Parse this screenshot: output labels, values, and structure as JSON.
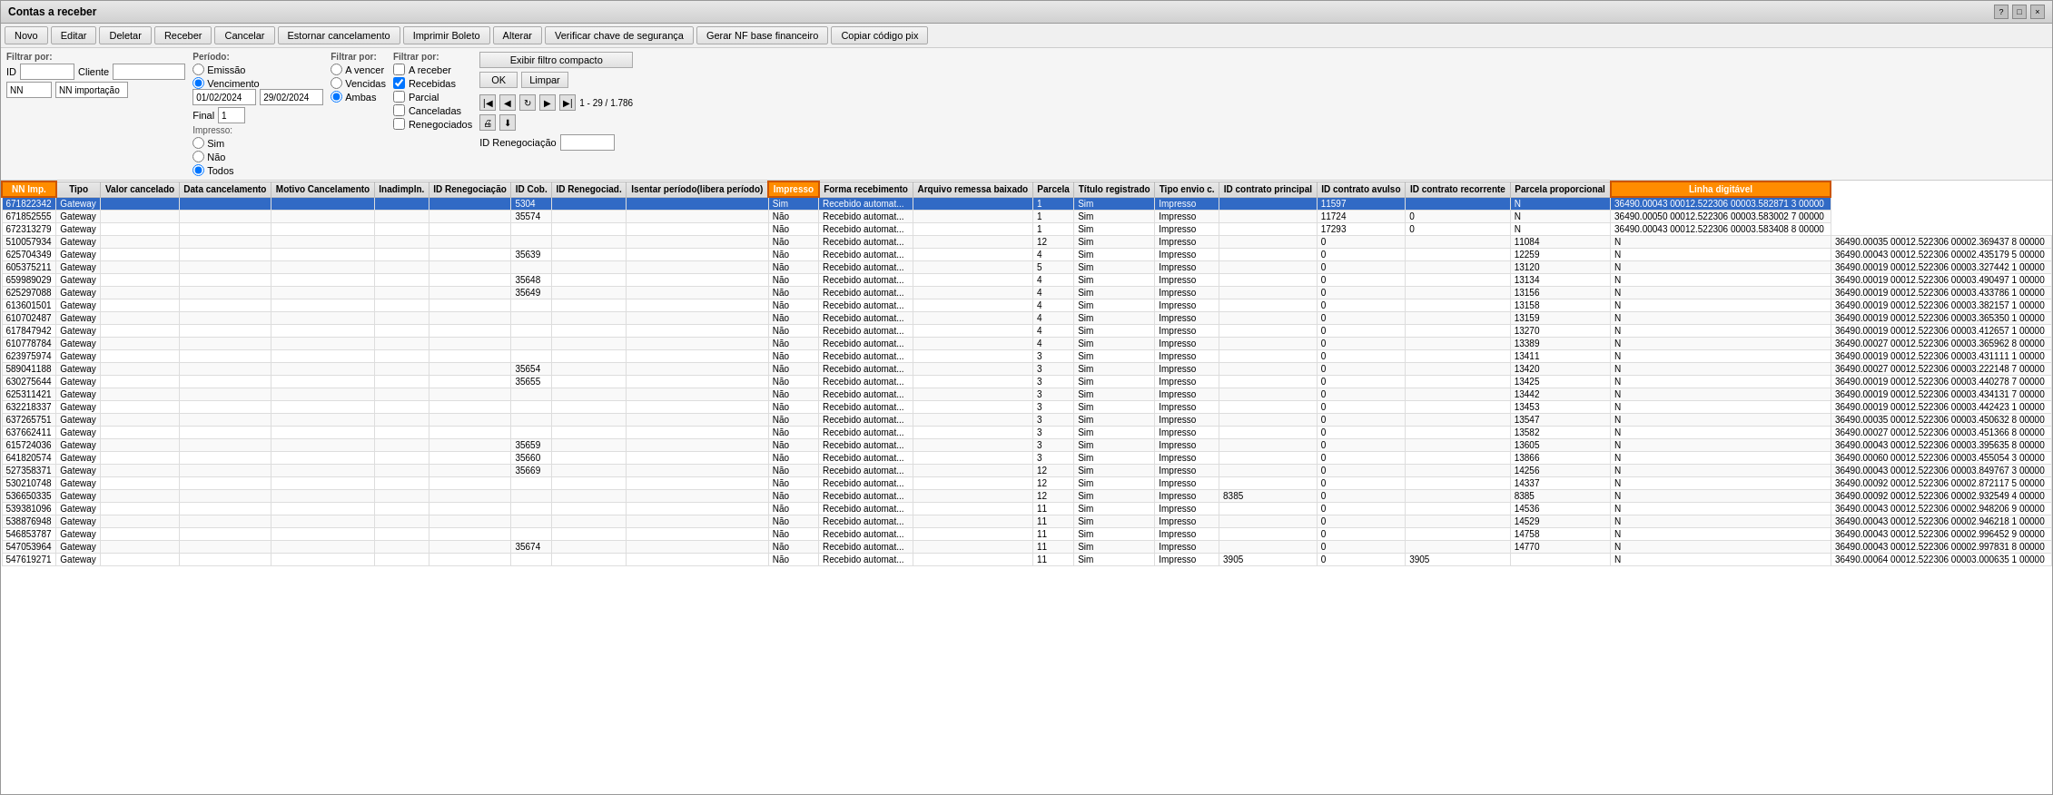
{
  "window": {
    "title": "Contas a receber",
    "title_buttons": [
      "?",
      "□",
      "×"
    ]
  },
  "toolbar": {
    "buttons": [
      "Novo",
      "Editar",
      "Deletar",
      "Receber",
      "Cancelar",
      "Estornar cancelamento",
      "Imprimir Boleto",
      "Alterar",
      "Verificar chave de segurança",
      "Gerar NF base financeiro",
      "Copiar código pix"
    ]
  },
  "filters": {
    "filtrar_por_label": "Filtrar por:",
    "id_label": "ID",
    "cliente_label": "Cliente",
    "nn_label": "NN",
    "nn_importacao_label": "NN importação",
    "periodo_label": "Período:",
    "emissao_label": "Emissão",
    "vencimento_label": "Vencimento",
    "final_label": "Final",
    "date_from": "01/02/2024",
    "date_to": "29/02/2024",
    "id_value": "",
    "cliente_value": "",
    "nn_value": "NN",
    "nn_imp_value": "NN importação",
    "final_value": "1",
    "impresso_label": "Impresso:",
    "impresso_sim": "Sim",
    "impresso_nao": "Não",
    "impresso_todos": "Todos",
    "filtrar_por2_label": "Filtrar por:",
    "a_vencer_label": "A vencer",
    "vencidas_label": "Vencidas",
    "ambas_label": "Ambas",
    "filtrar_por3_label": "Filtrar por:",
    "a_receber_label": "A receber",
    "recebidas_label": "Recebidas",
    "parcial_label": "Parcial",
    "canceladas_label": "Canceladas",
    "renegociados_label": "Renegociados",
    "exibir_filtro_compacto": "Exibir filtro compacto",
    "ok_label": "OK",
    "limpar_label": "Limpar",
    "nav_info": "1 - 29 / 1.786",
    "id_renegociacao_label": "ID Renegociação"
  },
  "table": {
    "columns": [
      "NN Imp.",
      "Tipo",
      "Valor cancelado",
      "Data cancelamento",
      "Motivo Cancelamento",
      "Inadimpln.",
      "ID Renegociação",
      "ID Cob.",
      "ID Renegociad.",
      "Isentar período(libera período)",
      "Impresso",
      "Forma recebimento",
      "Arquivo remessa baixado",
      "Parcela",
      "Título registrado",
      "Tipo envio c.",
      "ID contrato principal",
      "ID contrato avulso",
      "ID contrato recorrente",
      "Parcela proporcional",
      "Linha digitável"
    ],
    "rows": [
      [
        "671822342",
        "Gateway",
        "",
        "",
        "",
        "",
        "",
        "5304",
        "",
        "",
        "Sim",
        "Recebido automat...",
        "",
        "1",
        "Sim",
        "Impresso",
        "",
        "11597",
        "",
        "N",
        "36490.00043 00012.522306 00003.582871 3 00000"
      ],
      [
        "671852555",
        "Gateway",
        "",
        "",
        "",
        "",
        "",
        "35574",
        "",
        "",
        "Não",
        "Recebido automat...",
        "",
        "1",
        "Sim",
        "Impresso",
        "",
        "11724",
        "0",
        "N",
        "36490.00050 00012.522306 00003.583002 7 00000"
      ],
      [
        "672313279",
        "Gateway",
        "",
        "",
        "",
        "",
        "",
        "",
        "",
        "",
        "Não",
        "Recebido automat...",
        "",
        "1",
        "Sim",
        "Impresso",
        "",
        "17293",
        "0",
        "N",
        "36490.00043 00012.522306 00003.583408 8 00000"
      ],
      [
        "510057934",
        "Gateway",
        "",
        "",
        "",
        "",
        "",
        "",
        "",
        "",
        "Não",
        "Recebido automat...",
        "",
        "12",
        "Sim",
        "Impresso",
        "",
        "0",
        "",
        "11084",
        "N",
        "36490.00035 00012.522306 00002.369437 8 00000"
      ],
      [
        "625704349",
        "Gateway",
        "",
        "",
        "",
        "",
        "",
        "35639",
        "",
        "",
        "Não",
        "Recebido automat...",
        "",
        "4",
        "Sim",
        "Impresso",
        "",
        "0",
        "",
        "12259",
        "N",
        "36490.00043 00012.522306 00002.435179 5 00000"
      ],
      [
        "605375211",
        "Gateway",
        "",
        "",
        "",
        "",
        "",
        "",
        "",
        "",
        "Não",
        "Recebido automat...",
        "",
        "5",
        "Sim",
        "Impresso",
        "",
        "0",
        "",
        "13120",
        "N",
        "36490.00019 00012.522306 00003.327442 1 00000"
      ],
      [
        "659989029",
        "Gateway",
        "",
        "",
        "",
        "",
        "",
        "35648",
        "",
        "",
        "Não",
        "Recebido automat...",
        "",
        "4",
        "Sim",
        "Impresso",
        "",
        "0",
        "",
        "13134",
        "N",
        "36490.00019 00012.522306 00003.490497 1 00000"
      ],
      [
        "625297088",
        "Gateway",
        "",
        "",
        "",
        "",
        "",
        "35649",
        "",
        "",
        "Não",
        "Recebido automat...",
        "",
        "4",
        "Sim",
        "Impresso",
        "",
        "0",
        "",
        "13156",
        "N",
        "36490.00019 00012.522306 00003.433786 1 00000"
      ],
      [
        "613601501",
        "Gateway",
        "",
        "",
        "",
        "",
        "",
        "",
        "",
        "",
        "Não",
        "Recebido automat...",
        "",
        "4",
        "Sim",
        "Impresso",
        "",
        "0",
        "",
        "13158",
        "N",
        "36490.00019 00012.522306 00003.382157 1 00000"
      ],
      [
        "610702487",
        "Gateway",
        "",
        "",
        "",
        "",
        "",
        "",
        "",
        "",
        "Não",
        "Recebido automat...",
        "",
        "4",
        "Sim",
        "Impresso",
        "",
        "0",
        "",
        "13159",
        "N",
        "36490.00019 00012.522306 00003.365350 1 00000"
      ],
      [
        "617847942",
        "Gateway",
        "",
        "",
        "",
        "",
        "",
        "",
        "",
        "",
        "Não",
        "Recebido automat...",
        "",
        "4",
        "Sim",
        "Impresso",
        "",
        "0",
        "",
        "13270",
        "N",
        "36490.00019 00012.522306 00003.412657 1 00000"
      ],
      [
        "610778784",
        "Gateway",
        "",
        "",
        "",
        "",
        "",
        "",
        "",
        "",
        "Não",
        "Recebido automat...",
        "",
        "4",
        "Sim",
        "Impresso",
        "",
        "0",
        "",
        "13389",
        "N",
        "36490.00027 00012.522306 00003.365962 8 00000"
      ],
      [
        "623975974",
        "Gateway",
        "",
        "",
        "",
        "",
        "",
        "",
        "",
        "",
        "Não",
        "Recebido automat...",
        "",
        "3",
        "Sim",
        "Impresso",
        "",
        "0",
        "",
        "13411",
        "N",
        "36490.00019 00012.522306 00003.431111 1 00000"
      ],
      [
        "589041188",
        "Gateway",
        "",
        "",
        "",
        "",
        "",
        "35654",
        "",
        "",
        "Não",
        "Recebido automat...",
        "",
        "3",
        "Sim",
        "Impresso",
        "",
        "0",
        "",
        "13420",
        "N",
        "36490.00027 00012.522306 00003.222148 7 00000"
      ],
      [
        "630275644",
        "Gateway",
        "",
        "",
        "",
        "",
        "",
        "35655",
        "",
        "",
        "Não",
        "Recebido automat...",
        "",
        "3",
        "Sim",
        "Impresso",
        "",
        "0",
        "",
        "13425",
        "N",
        "36490.00019 00012.522306 00003.440278 7 00000"
      ],
      [
        "625311421",
        "Gateway",
        "",
        "",
        "",
        "",
        "",
        "",
        "",
        "",
        "Não",
        "Recebido automat...",
        "",
        "3",
        "Sim",
        "Impresso",
        "",
        "0",
        "",
        "13442",
        "N",
        "36490.00019 00012.522306 00003.434131 7 00000"
      ],
      [
        "632218337",
        "Gateway",
        "",
        "",
        "",
        "",
        "",
        "",
        "",
        "",
        "Não",
        "Recebido automat...",
        "",
        "3",
        "Sim",
        "Impresso",
        "",
        "0",
        "",
        "13453",
        "N",
        "36490.00019 00012.522306 00003.442423 1 00000"
      ],
      [
        "637265751",
        "Gateway",
        "",
        "",
        "",
        "",
        "",
        "",
        "",
        "",
        "Não",
        "Recebido automat...",
        "",
        "3",
        "Sim",
        "Impresso",
        "",
        "0",
        "",
        "13547",
        "N",
        "36490.00035 00012.522306 00003.450632 8 00000"
      ],
      [
        "637662411",
        "Gateway",
        "",
        "",
        "",
        "",
        "",
        "",
        "",
        "",
        "Não",
        "Recebido automat...",
        "",
        "3",
        "Sim",
        "Impresso",
        "",
        "0",
        "",
        "13582",
        "N",
        "36490.00027 00012.522306 00003.451366 8 00000"
      ],
      [
        "615724036",
        "Gateway",
        "",
        "",
        "",
        "",
        "",
        "35659",
        "",
        "",
        "Não",
        "Recebido automat...",
        "",
        "3",
        "Sim",
        "Impresso",
        "",
        "0",
        "",
        "13605",
        "N",
        "36490.00043 00012.522306 00003.395635 8 00000"
      ],
      [
        "641820574",
        "Gateway",
        "",
        "",
        "",
        "",
        "",
        "35660",
        "",
        "",
        "Não",
        "Recebido automat...",
        "",
        "3",
        "Sim",
        "Impresso",
        "",
        "0",
        "",
        "13866",
        "N",
        "36490.00060 00012.522306 00003.455054 3 00000"
      ],
      [
        "527358371",
        "Gateway",
        "",
        "",
        "",
        "",
        "",
        "35669",
        "",
        "",
        "Não",
        "Recebido automat...",
        "",
        "12",
        "Sim",
        "Impresso",
        "",
        "0",
        "",
        "14256",
        "N",
        "36490.00043 00012.522306 00003.849767 3 00000"
      ],
      [
        "530210748",
        "Gateway",
        "",
        "",
        "",
        "",
        "",
        "",
        "",
        "",
        "Não",
        "Recebido automat...",
        "",
        "12",
        "Sim",
        "Impresso",
        "",
        "0",
        "",
        "14337",
        "N",
        "36490.00092 00012.522306 00002.872117 5 00000"
      ],
      [
        "536650335",
        "Gateway",
        "",
        "",
        "",
        "",
        "",
        "",
        "",
        "",
        "Não",
        "Recebido automat...",
        "",
        "12",
        "Sim",
        "Impresso",
        "8385",
        "0",
        "",
        "8385",
        "N",
        "36490.00092 00012.522306 00002.932549 4 00000"
      ],
      [
        "539381096",
        "Gateway",
        "",
        "",
        "",
        "",
        "",
        "",
        "",
        "",
        "Não",
        "Recebido automat...",
        "",
        "11",
        "Sim",
        "Impresso",
        "",
        "0",
        "",
        "14536",
        "N",
        "36490.00043 00012.522306 00002.948206 9 00000"
      ],
      [
        "538876948",
        "Gateway",
        "",
        "",
        "",
        "",
        "",
        "",
        "",
        "",
        "Não",
        "Recebido automat...",
        "",
        "11",
        "Sim",
        "Impresso",
        "",
        "0",
        "",
        "14529",
        "N",
        "36490.00043 00012.522306 00002.946218 1 00000"
      ],
      [
        "546853787",
        "Gateway",
        "",
        "",
        "",
        "",
        "",
        "",
        "",
        "",
        "Não",
        "Recebido automat...",
        "",
        "11",
        "Sim",
        "Impresso",
        "",
        "0",
        "",
        "14758",
        "N",
        "36490.00043 00012.522306 00002.996452 9 00000"
      ],
      [
        "547053964",
        "Gateway",
        "",
        "",
        "",
        "",
        "",
        "35674",
        "",
        "",
        "Não",
        "Recebido automat...",
        "",
        "11",
        "Sim",
        "Impresso",
        "",
        "0",
        "",
        "14770",
        "N",
        "36490.00043 00012.522306 00002.997831 8 00000"
      ],
      [
        "547619271",
        "Gateway",
        "",
        "",
        "",
        "",
        "",
        "",
        "",
        "",
        "Não",
        "Recebido automat...",
        "",
        "11",
        "Sim",
        "Impresso",
        "3905",
        "0",
        "3905",
        "",
        "N",
        "36490.00064 00012.522306 00003.000635 1 00000"
      ]
    ]
  },
  "highlighted_cols": [
    10,
    20
  ],
  "colors": {
    "selected_row_bg": "#316AC5",
    "selected_row_text": "#ffffff",
    "header_bg": "#e8e8e8",
    "highlight_orange": "#ff6600",
    "window_bg": "#f0f0f0"
  }
}
